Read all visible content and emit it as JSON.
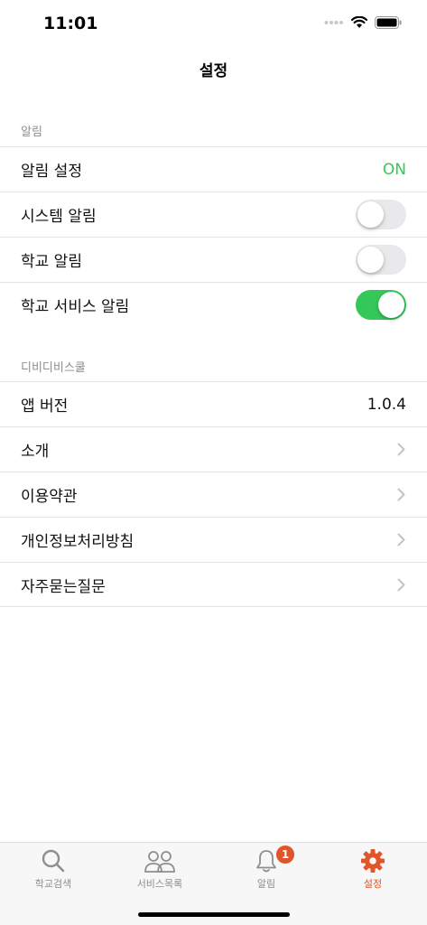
{
  "status_bar": {
    "time": "11:01"
  },
  "nav": {
    "title": "설정"
  },
  "sections": {
    "alerts": {
      "header": "알림",
      "alert_setting": {
        "label": "알림 설정",
        "value": "ON"
      },
      "system_alert": {
        "label": "시스템 알림",
        "on": false
      },
      "school_alert": {
        "label": "학교 알림",
        "on": false
      },
      "school_service_alert": {
        "label": "학교 서비스 알림",
        "on": true
      }
    },
    "app": {
      "header": "디비디비스쿨",
      "version": {
        "label": "앱 버전",
        "value": "1.0.4"
      },
      "intro": {
        "label": "소개"
      },
      "terms": {
        "label": "이용약관"
      },
      "privacy": {
        "label": "개인정보처리방침"
      },
      "faq": {
        "label": "자주묻는질문"
      }
    }
  },
  "tab_bar": {
    "school_search": {
      "label": "학교검색",
      "icon": "search-icon"
    },
    "service_list": {
      "label": "서비스목록",
      "icon": "people-icon"
    },
    "alerts": {
      "label": "알림",
      "icon": "bell-icon",
      "badge": "1"
    },
    "settings": {
      "label": "설정",
      "icon": "gear-icon"
    }
  },
  "colors": {
    "accent": "#e0552a",
    "toggle_on": "#34c759",
    "on_text": "#34c759"
  }
}
